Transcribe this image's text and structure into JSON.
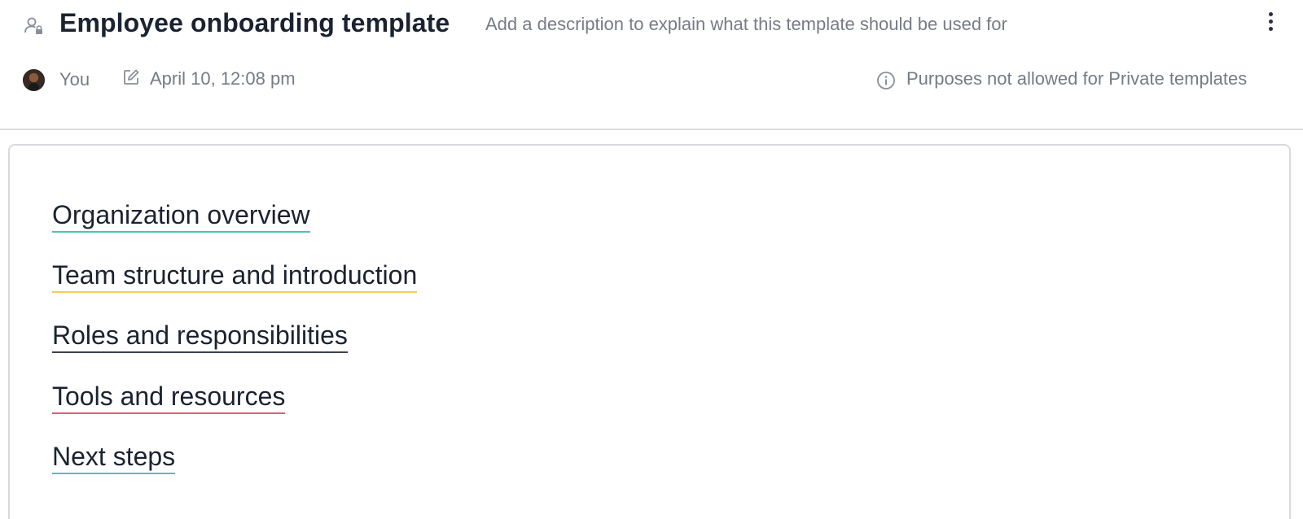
{
  "header": {
    "title": "Employee onboarding template",
    "description": "Add a description to explain what this template should be used for",
    "icon": "private-template-icon",
    "menu_icon": "more-vertical-icon"
  },
  "meta": {
    "owner": "You",
    "edited_at": "April 10, 12:08 pm",
    "purposes_note": "Purposes not allowed for Private templates"
  },
  "sections": [
    {
      "label": "Organization overview",
      "color": "#4cc3b8"
    },
    {
      "label": "Team structure and introduction",
      "color": "#f2cd57"
    },
    {
      "label": "Roles and responsibilities",
      "color": "#3b4150"
    },
    {
      "label": "Tools and resources",
      "color": "#e45b7b"
    },
    {
      "label": "Next steps",
      "color": "#4cc3b8"
    }
  ]
}
